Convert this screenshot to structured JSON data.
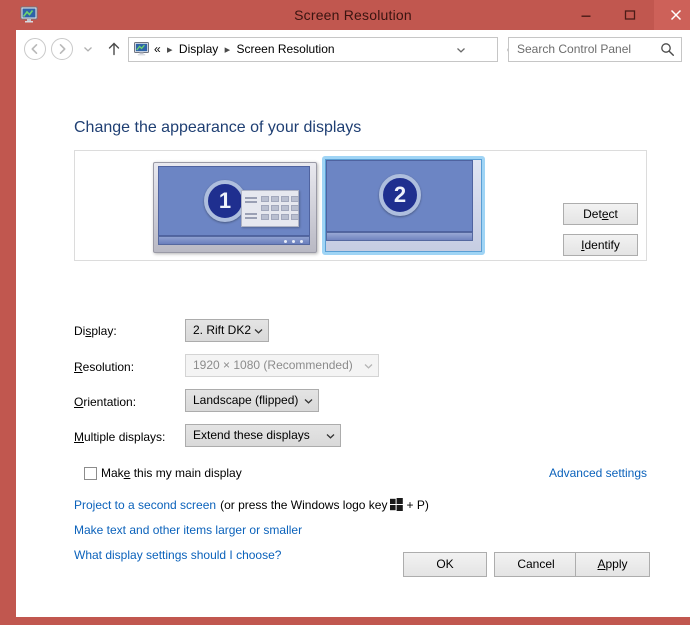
{
  "window": {
    "title": "Screen Resolution",
    "icon": "display-icon",
    "frame_color": "#c1574f",
    "controls": {
      "minimize": "minimize-icon",
      "maximize": "maximize-icon",
      "close": "close-icon"
    }
  },
  "navbar": {
    "back": "back-arrow-icon",
    "forward": "forward-arrow-icon",
    "recent": "recent-pages-chevron-icon",
    "up": "up-arrow-icon",
    "address_icon": "display-icon",
    "breadcrumbs": [
      "«",
      "Display",
      "Screen Resolution"
    ],
    "separator": "▸",
    "dropdown": "chevron-down-icon",
    "refresh": "refresh-icon",
    "search": {
      "placeholder": "Search Control Panel",
      "icon": "search-icon"
    }
  },
  "page": {
    "title": "Change the appearance of your displays"
  },
  "preview": {
    "monitors": [
      {
        "number": "1",
        "selected": false,
        "has_tiles": true
      },
      {
        "number": "2",
        "selected": true,
        "has_tiles": false
      }
    ],
    "buttons": {
      "detect": {
        "before": "Det",
        "accel": "e",
        "after": "ct"
      },
      "identify": {
        "before": "",
        "accel": "I",
        "after": "dentify"
      }
    }
  },
  "form": {
    "display": {
      "label": {
        "before": "Di",
        "accel": "s",
        "after": "play:"
      },
      "value": "2. Rift DK2",
      "enabled": true
    },
    "resolution": {
      "label": {
        "before": "",
        "accel": "R",
        "after": "esolution:"
      },
      "value": "1920 × 1080 (Recommended)",
      "enabled": false
    },
    "orientation": {
      "label": {
        "before": "",
        "accel": "O",
        "after": "rientation:"
      },
      "value": "Landscape (flipped)",
      "enabled": true
    },
    "multiple_displays": {
      "label": {
        "before": "",
        "accel": "M",
        "after": "ultiple displays:"
      },
      "value": "Extend these displays",
      "enabled": true
    }
  },
  "options": {
    "main_display_checkbox": {
      "before": "Mak",
      "accel": "e",
      "after": " this my main display",
      "checked": false
    },
    "advanced_settings_link": "Advanced settings"
  },
  "links": {
    "project_link": "Project to a second screen",
    "project_suffix_before": "(or press the Windows logo key",
    "project_suffix_after": "+ P)",
    "windows_key_icon": "windows-logo-icon",
    "make_text": "Make text and other items larger or smaller",
    "what_settings": "What display settings should I choose?"
  },
  "footer": {
    "ok": "OK",
    "cancel": "Cancel",
    "apply": {
      "before": "",
      "accel": "A",
      "after": "pply"
    }
  },
  "colors": {
    "frame": "#c1574f",
    "link": "#0b62bb",
    "heading": "#1f3f73",
    "screen_blue": "#6c85c4",
    "badge_navy": "#1f2f8f",
    "selection_blue": "#9fd4f5"
  }
}
